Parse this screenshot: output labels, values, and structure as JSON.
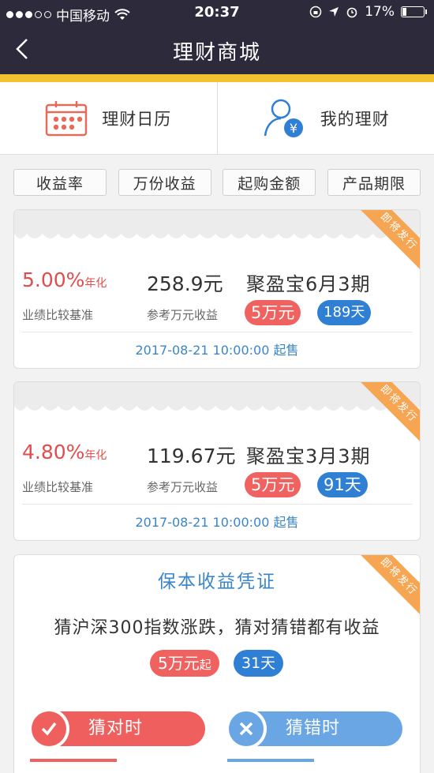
{
  "status_bar": {
    "carrier": "中国移动",
    "time": "20:37",
    "battery": "17%"
  },
  "nav": {
    "title": "理财商城"
  },
  "quick_entries": [
    {
      "label": "理财日历",
      "icon": "calendar-icon"
    },
    {
      "label": "我的理财",
      "icon": "user-yuan-icon"
    }
  ],
  "filters": [
    "收益率",
    "万份收益",
    "起购金额",
    "产品期限"
  ],
  "products": [
    {
      "ribbon": "即将发行",
      "rate": "5.00%",
      "rate_suffix": "年化",
      "rate_label": "业绩比较基准",
      "income": "258.9元",
      "income_label": "参考万元收益",
      "name": "聚盈宝6月3期",
      "amount": "5万元",
      "days": "189天",
      "sale_time": "2017-08-21 10:00:00 起售"
    },
    {
      "ribbon": "即将发行",
      "rate": "4.80%",
      "rate_suffix": "年化",
      "rate_label": "业绩比较基准",
      "income": "119.67元",
      "income_label": "参考万元收益",
      "name": "聚盈宝3月3期",
      "amount": "5万元",
      "days": "91天",
      "sale_time": "2017-08-21 10:00:00 起售"
    }
  ],
  "guarantee": {
    "ribbon": "即将发行",
    "title": "保本收益凭证",
    "description": "猜沪深300指数涨跌，猜对猜错都有收益",
    "amount": "5万元",
    "amount_suffix": "起",
    "days": "31天",
    "guess_right": "猜对时",
    "guess_wrong": "猜错时"
  },
  "colors": {
    "header": "#2d2a3c",
    "accent_gold": "#f2c230",
    "rate_red": "#e34c4c",
    "badge_blue": "#2f7fd5",
    "ribbon_orange": "#f6a552"
  }
}
